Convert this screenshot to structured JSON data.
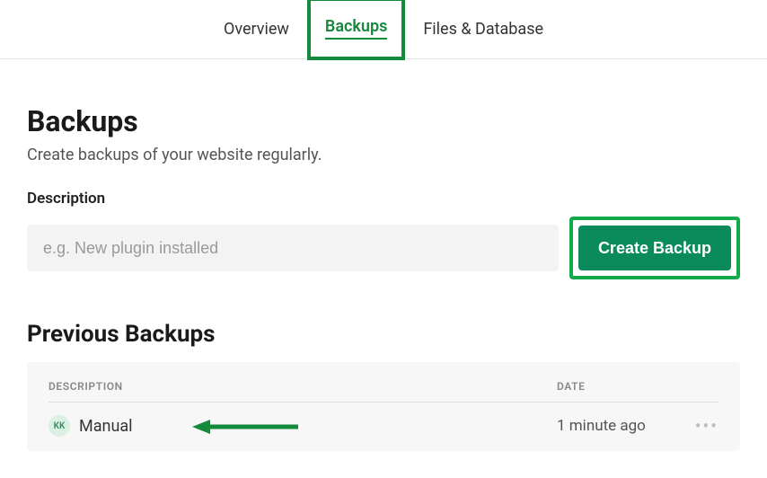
{
  "tabs": {
    "overview": "Overview",
    "backups": "Backups",
    "files_db": "Files & Database"
  },
  "header": {
    "title": "Backups",
    "subtitle": "Create backups of your website regularly."
  },
  "create": {
    "field_label": "Description",
    "placeholder": "e.g. New plugin installed",
    "value": "",
    "button_label": "Create Backup"
  },
  "previous": {
    "title": "Previous Backups",
    "columns": {
      "description": "DESCRIPTION",
      "date": "DATE"
    },
    "rows": [
      {
        "avatar_initials": "KK",
        "description": "Manual",
        "date": "1 minute ago"
      }
    ]
  },
  "colors": {
    "accent": "#148a3c",
    "button_bg": "#0b8a5c"
  }
}
